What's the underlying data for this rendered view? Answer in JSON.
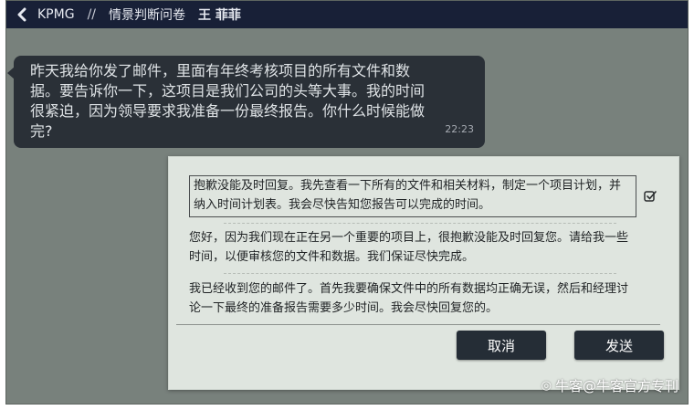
{
  "header": {
    "org": "KPMG",
    "separator": "//",
    "title": "情景判断问卷",
    "user": "王 菲菲"
  },
  "chat": {
    "message": "昨天我给你发了邮件，里面有年终考核项目的所有文件和数据。要告诉你一下，这项目是我们公司的头等大事。我的时间很紧迫，因为领导要求我准备一份最终报告。你什么时候能做完?",
    "time": "22:23"
  },
  "reply_options": [
    {
      "text": "抱歉没能及时回复。我先查看一下所有的文件和相关材料，制定一个项目计划，并纳入时间计划表。我会尽快告知您报告可以完成的时间。",
      "selected": true
    },
    {
      "text": "您好，因为我们现在正在另一个重要的项目上，很抱歉没能及时回复您。请给我一些时间，以便审核您的文件和数据。我们保证尽快完成。",
      "selected": false
    },
    {
      "text": "我已经收到您的邮件了。首先我要确保文件中的所有数据均正确无误，然后和经理讨论一下最终的准备报告需要多少时间。我会尽快回复您的。",
      "selected": false
    }
  ],
  "buttons": {
    "cancel": "取消",
    "send": "发送"
  },
  "watermark": "牛客@牛客官方专刊",
  "colors": {
    "topbar": "#182037",
    "background": "#78817c",
    "bubble": "#2a3037",
    "panel": "#dfe5df",
    "button": "#252d36"
  }
}
